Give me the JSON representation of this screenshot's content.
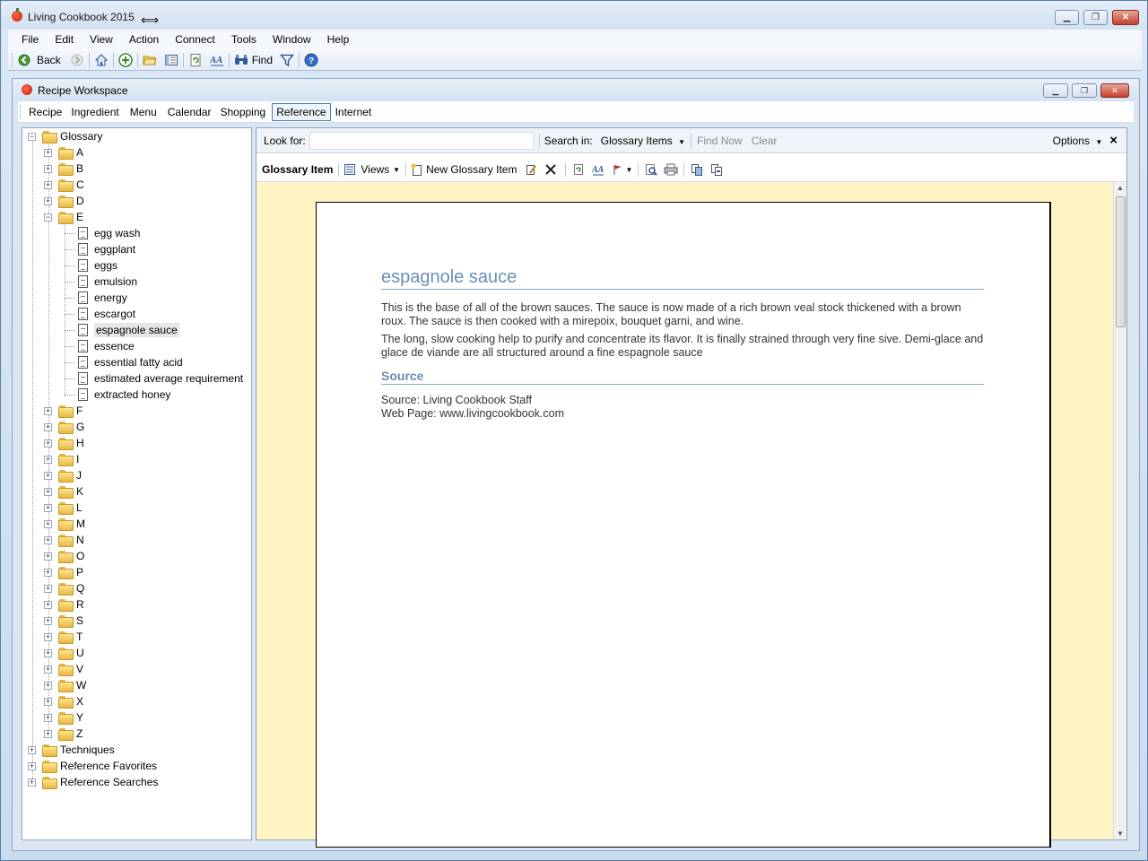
{
  "window": {
    "title": "Living Cookbook 2015",
    "cursor": "⟺"
  },
  "menubar": [
    "File",
    "Edit",
    "View",
    "Action",
    "Connect",
    "Tools",
    "Window",
    "Help"
  ],
  "toolbar": {
    "back_label": "Back",
    "find_label": "Find"
  },
  "child": {
    "title": "Recipe Workspace"
  },
  "navtabs": [
    "Recipe",
    "Ingredient",
    "Menu",
    "Calendar",
    "Shopping",
    "Reference",
    "Internet"
  ],
  "tree": {
    "root": "Glossary",
    "letters_before": [
      "A",
      "B",
      "C",
      "D"
    ],
    "expanded_letter": "E",
    "e_items": [
      "egg wash",
      "eggplant",
      "eggs",
      "emulsion",
      "energy",
      "escargot",
      "espagnole sauce",
      "essence",
      "essential fatty acid",
      "estimated average requirement",
      "extracted honey"
    ],
    "selected_item": "espagnole sauce",
    "letters_after": [
      "F",
      "G",
      "H",
      "I",
      "J",
      "K",
      "L",
      "M",
      "N",
      "O",
      "P",
      "Q",
      "R",
      "S",
      "T",
      "U",
      "V",
      "W",
      "X",
      "Y",
      "Z"
    ],
    "siblings": [
      "Techniques",
      "Reference Favorites",
      "Reference Searches"
    ]
  },
  "search": {
    "look_for_label": "Look for:",
    "look_for_value": "",
    "search_in_label": "Search in:",
    "search_in_value": "Glossary Items",
    "find_now": "Find Now",
    "clear": "Clear",
    "options": "Options",
    "close": "×"
  },
  "itembar": {
    "title": "Glossary Item",
    "views": "Views",
    "new_item": "New Glossary Item"
  },
  "document": {
    "title": "espagnole sauce",
    "para1": "This is the base of all of the brown sauces. The sauce is now made of a rich brown veal stock thickened with a brown roux. The sauce is then cooked with a mirepoix, bouquet garni, and wine.",
    "para2": "The long, slow cooking help to purify and concentrate its flavor. It is finally strained through very fine sive. Demi-glace and glace de viande are all structured around a fine espagnole sauce",
    "source_heading": "Source",
    "source_line": "Source: Living Cookbook Staff",
    "webpage_line": "Web Page: www.livingcookbook.com"
  }
}
